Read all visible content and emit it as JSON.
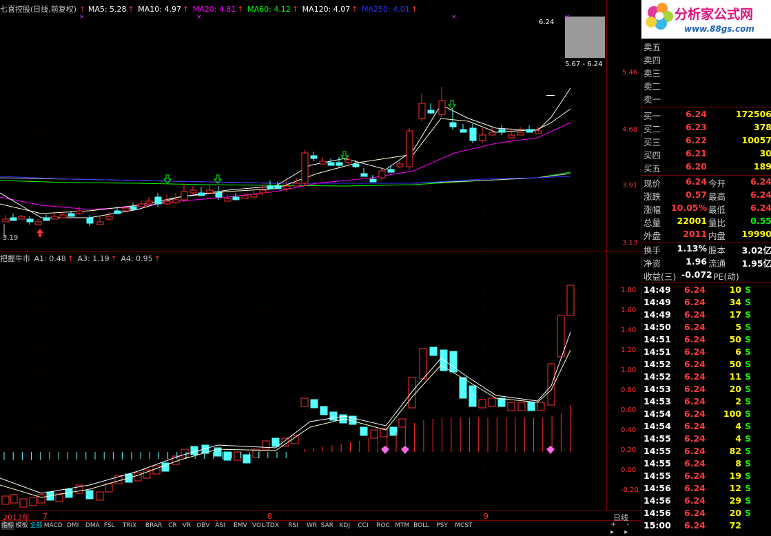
{
  "logo": {
    "title": "分析家公式网",
    "url": "www.88gs.com"
  },
  "main_legend": {
    "title": "七喜控股(日线,前复权)",
    "items": [
      {
        "label": "MA5: 5.28",
        "color": "#ffffff"
      },
      {
        "label": "MA10: 4.97",
        "color": "#ffffff"
      },
      {
        "label": "MA20: 4.81",
        "color": "#ff00ff"
      },
      {
        "label": "MA60: 4.12",
        "color": "#00ff00"
      },
      {
        "label": "MA120: 4.07",
        "color": "#ffffff"
      },
      {
        "label": "MA250: 4.01",
        "color": "#3030ff"
      }
    ]
  },
  "sub_legend": {
    "title": "把握牛市",
    "items": [
      {
        "label": "A1: 0.48",
        "color": "#ffffff"
      },
      {
        "label": "A3: 1.19",
        "color": "#ffffff"
      },
      {
        "label": "A4: 0.95",
        "color": "#ffffff"
      }
    ]
  },
  "price_axis": [
    "5.46",
    "4.68",
    "3.91",
    "3.13"
  ],
  "sub_axis": [
    "1.80",
    "1.60",
    "1.40",
    "1.20",
    "1.00",
    "0.80",
    "0.60",
    "0.40",
    "0.20",
    "0.00",
    "-0.20"
  ],
  "annotations": {
    "high_mark": "6.24",
    "range": "5.67 - 6.24",
    "low_mark": "3.19"
  },
  "time_axis": {
    "year": "2013年",
    "months": [
      "7",
      "8",
      "9"
    ],
    "period": "日线"
  },
  "tabs": [
    "指标",
    "模板",
    "全部",
    "MACD",
    "DMI",
    "DMA",
    "FSL",
    "TRIX",
    "BRAR",
    "CR",
    "VR",
    "OBV",
    "ASI",
    "EMV",
    "VOL-TDX",
    "RSI",
    "WR",
    "SAR",
    "KDJ",
    "CCI",
    "ROC",
    "MTM",
    "BOLL",
    "PSY",
    "MCST"
  ],
  "order_book": {
    "sells": [
      {
        "label": "卖五"
      },
      {
        "label": "卖四"
      },
      {
        "label": "卖三"
      },
      {
        "label": "卖二"
      },
      {
        "label": "卖一"
      }
    ],
    "buys": [
      {
        "label": "买一",
        "price": "6.24",
        "vol": "172506"
      },
      {
        "label": "买二",
        "price": "6.23",
        "vol": "378"
      },
      {
        "label": "买三",
        "price": "6.22",
        "vol": "10057"
      },
      {
        "label": "买四",
        "price": "6.21",
        "vol": "30"
      },
      {
        "label": "买五",
        "price": "6.20",
        "vol": "189"
      }
    ]
  },
  "quote": [
    {
      "l1": "现价",
      "v1": "6.24",
      "l2": "今开",
      "v2": "6.24"
    },
    {
      "l1": "涨跌",
      "v1": "0.57",
      "l2": "最高",
      "v2": "6.24"
    },
    {
      "l1": "涨幅",
      "v1": "10.05%",
      "l2": "最低",
      "v2": "6.24"
    },
    {
      "l1": "总量",
      "v1": "22001",
      "l2": "量比",
      "v2": "0.55"
    },
    {
      "l1": "外盘",
      "v1": "2011",
      "l2": "内盘",
      "v2": "19990"
    }
  ],
  "fundamentals": [
    {
      "l1": "换手",
      "v1": "1.13%",
      "l2": "股本",
      "v2": "3.02亿"
    },
    {
      "l1": "净资",
      "v1": "1.96",
      "l2": "流通",
      "v2": "1.95亿"
    }
  ],
  "earnings": {
    "label": "收益(三)",
    "value": "-0.072",
    "pe": "PE(动)"
  },
  "ticks": [
    {
      "time": "14:49",
      "price": "6.24",
      "vol": "10",
      "side": "S"
    },
    {
      "time": "14:49",
      "price": "6.24",
      "vol": "34",
      "side": "S"
    },
    {
      "time": "14:49",
      "price": "6.24",
      "vol": "17",
      "side": "S"
    },
    {
      "time": "14:50",
      "price": "6.24",
      "vol": "5",
      "side": "S"
    },
    {
      "time": "14:51",
      "price": "6.24",
      "vol": "50",
      "side": "S"
    },
    {
      "time": "14:51",
      "price": "6.24",
      "vol": "6",
      "side": "S"
    },
    {
      "time": "14:52",
      "price": "6.24",
      "vol": "50",
      "side": "S"
    },
    {
      "time": "14:52",
      "price": "6.24",
      "vol": "11",
      "side": "S"
    },
    {
      "time": "14:53",
      "price": "6.24",
      "vol": "20",
      "side": "S"
    },
    {
      "time": "14:53",
      "price": "6.24",
      "vol": "2",
      "side": "S"
    },
    {
      "time": "14:54",
      "price": "6.24",
      "vol": "100",
      "side": "S"
    },
    {
      "time": "14:54",
      "price": "6.24",
      "vol": "4",
      "side": "S"
    },
    {
      "time": "14:55",
      "price": "6.24",
      "vol": "4",
      "side": "S"
    },
    {
      "time": "14:55",
      "price": "6.24",
      "vol": "82",
      "side": "S"
    },
    {
      "time": "14:55",
      "price": "6.24",
      "vol": "8",
      "side": "S"
    },
    {
      "time": "14:55",
      "price": "6.24",
      "vol": "19",
      "side": "S"
    },
    {
      "time": "14:56",
      "price": "6.24",
      "vol": "12",
      "side": "S"
    },
    {
      "time": "14:56",
      "price": "6.24",
      "vol": "29",
      "side": "S"
    },
    {
      "time": "14:56",
      "price": "6.24",
      "vol": "20",
      "side": "S"
    },
    {
      "time": "15:00",
      "price": "6.24",
      "vol": "72",
      "side": ""
    }
  ],
  "colors": {
    "up": "#ff3030",
    "down": "#54ffff",
    "panel_red": "#ff3c3c",
    "yellow": "#ffff00",
    "green": "#00ff00",
    "separator": "#7a0000"
  }
}
